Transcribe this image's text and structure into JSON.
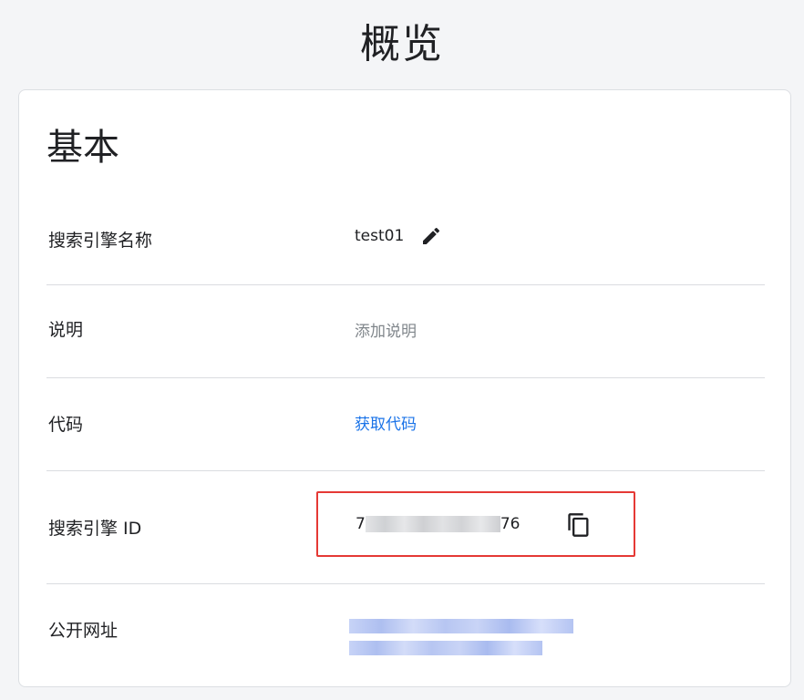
{
  "page": {
    "title": "概览"
  },
  "basic": {
    "title": "基本",
    "rows": [
      {
        "label": "搜索引擎名称",
        "value": "test01",
        "icon": "pencil-edit-icon"
      },
      {
        "label": "说明",
        "value": "添加说明"
      },
      {
        "label": "代码",
        "value": "获取代码"
      },
      {
        "label": "搜索引擎 ID",
        "value_prefix": "7",
        "value_suffix": "76",
        "icon": "copy-icon"
      },
      {
        "label": "公开网址"
      }
    ]
  },
  "colors": {
    "link": "#1a73e8",
    "highlight_border": "#e53935",
    "background": "#f4f5f7"
  }
}
